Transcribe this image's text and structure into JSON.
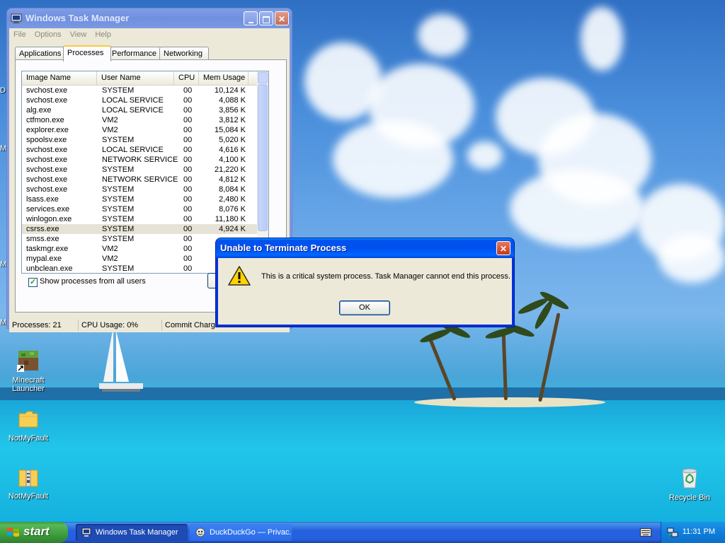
{
  "desktop": {
    "icons": [
      {
        "label_line1": "Minecraft",
        "label_line2": "Launcher"
      },
      {
        "label_line1": "NotMyFault",
        "label_line2": ""
      },
      {
        "label_line1": "NotMyFault",
        "label_line2": ""
      },
      {
        "label_line1": "Recycle Bin",
        "label_line2": ""
      }
    ],
    "edge_letters": [
      "D",
      "M",
      "M",
      "M"
    ]
  },
  "task_manager": {
    "title": "Windows Task Manager",
    "menu": [
      "File",
      "Options",
      "View",
      "Help"
    ],
    "tabs": [
      "Applications",
      "Processes",
      "Performance",
      "Networking"
    ],
    "selected_tab": "Processes",
    "columns": [
      "Image Name",
      "User Name",
      "CPU",
      "Mem Usage"
    ],
    "processes": [
      [
        "svchost.exe",
        "SYSTEM",
        "00",
        "10,124 K"
      ],
      [
        "svchost.exe",
        "LOCAL SERVICE",
        "00",
        "4,088 K"
      ],
      [
        "alg.exe",
        "LOCAL SERVICE",
        "00",
        "3,856 K"
      ],
      [
        "ctfmon.exe",
        "VM2",
        "00",
        "3,812 K"
      ],
      [
        "explorer.exe",
        "VM2",
        "00",
        "15,084 K"
      ],
      [
        "spoolsv.exe",
        "SYSTEM",
        "00",
        "5,020 K"
      ],
      [
        "svchost.exe",
        "LOCAL SERVICE",
        "00",
        "4,616 K"
      ],
      [
        "svchost.exe",
        "NETWORK SERVICE",
        "00",
        "4,100 K"
      ],
      [
        "svchost.exe",
        "SYSTEM",
        "00",
        "21,220 K"
      ],
      [
        "svchost.exe",
        "NETWORK SERVICE",
        "00",
        "4,812 K"
      ],
      [
        "svchost.exe",
        "SYSTEM",
        "00",
        "8,084 K"
      ],
      [
        "lsass.exe",
        "SYSTEM",
        "00",
        "2,480 K"
      ],
      [
        "services.exe",
        "SYSTEM",
        "00",
        "8,076 K"
      ],
      [
        "winlogon.exe",
        "SYSTEM",
        "00",
        "11,180 K"
      ],
      [
        "csrss.exe",
        "SYSTEM",
        "00",
        "4,924 K"
      ],
      [
        "smss.exe",
        "SYSTEM",
        "00",
        ""
      ],
      [
        "taskmgr.exe",
        "VM2",
        "00",
        ""
      ],
      [
        "mypal.exe",
        "VM2",
        "00",
        ""
      ],
      [
        "unbclean.exe",
        "SYSTEM",
        "00",
        ""
      ]
    ],
    "selected_process_index": 14,
    "show_all_users_label": "Show processes from all users",
    "show_all_users_checked": true,
    "status": {
      "processes": "Processes: 21",
      "cpu": "CPU Usage: 0%",
      "commit": "Commit Charge"
    }
  },
  "error_dialog": {
    "title": "Unable to Terminate Process",
    "message": "This is a critical system process.  Task Manager cannot end this process.",
    "ok_label": "OK",
    "icon": "warning-icon"
  },
  "taskbar": {
    "start_label": "start",
    "tasks": [
      {
        "label": "Windows Task Manager",
        "active": true
      },
      {
        "label": "DuckDuckGo — Privac...",
        "active": false
      }
    ],
    "clock": "11:31 PM"
  },
  "colors": {
    "xp_title_blue": "#0053ee",
    "start_green": "#3c9e3c",
    "dialog_bg": "#ece9d8",
    "close_red": "#c3381a"
  }
}
